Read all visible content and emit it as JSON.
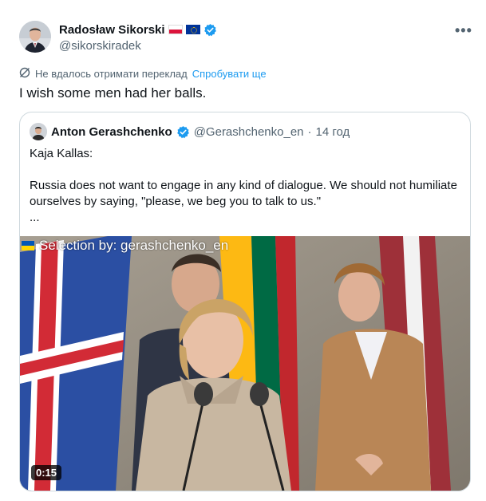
{
  "author": {
    "name": "Radosław Sikorski",
    "handle": "@sikorskiradek",
    "flags": [
      "polish-flag",
      "eu-flag"
    ],
    "verified": true
  },
  "more_label": "•••",
  "translation": {
    "status_text": "Не вдалось отримати переклад",
    "retry_label": "Спробувати ще"
  },
  "tweet_text": "I wish some men had her balls.",
  "quoted_tweet": {
    "name": "Anton Gerashchenko",
    "handle": "@Gerashchenko_en",
    "separator": "·",
    "time": "14 год",
    "text_lines": [
      "Kaja Kallas:",
      "",
      "Russia does not want to engage in any kind of dialogue. We should not humiliate ourselves by saying, \"please, we beg you to talk to us.\"",
      "..."
    ],
    "video": {
      "caption": "Selection by: gerashchenko_en",
      "duration": "0:15"
    }
  },
  "colors": {
    "accent": "#1d9bf0",
    "text_primary": "#0f1419",
    "text_secondary": "#536471",
    "border": "#cfd9de"
  }
}
